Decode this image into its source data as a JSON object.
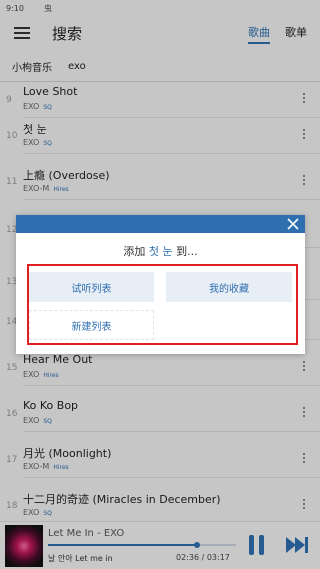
{
  "status": {
    "time": "9:10",
    "bug": "虫"
  },
  "app_bar": {
    "title": "搜索",
    "tab_songs": "歌曲",
    "tab_playlists": "歌单"
  },
  "search": {
    "source": "小枸音乐",
    "query": "exo"
  },
  "songs": [
    {
      "num": "9",
      "title": "Love Shot",
      "artist": "EXO",
      "badge": "SQ"
    },
    {
      "num": "10",
      "title": "첫 눈",
      "artist": "EXO",
      "badge": "SQ"
    },
    {
      "num": "11",
      "title": "上瘾 (Overdose)",
      "artist": "EXO-M",
      "badge": "Hires"
    },
    {
      "num": "12",
      "title": "",
      "artist": "",
      "badge": ""
    },
    {
      "num": "13",
      "title": "",
      "artist": "",
      "badge": ""
    },
    {
      "num": "14",
      "title": "",
      "artist": "",
      "badge": ""
    },
    {
      "num": "15",
      "title": "Hear Me Out",
      "artist": "EXO",
      "badge": "Hires"
    },
    {
      "num": "16",
      "title": "Ko Ko Bop",
      "artist": "EXO",
      "badge": "SQ"
    },
    {
      "num": "17",
      "title": "月光 (Moonlight)",
      "artist": "EXO-M",
      "badge": "Hires"
    },
    {
      "num": "18",
      "title": "十二月的奇迹 (Miracles in December)",
      "artist": "EXO",
      "badge": "SQ"
    }
  ],
  "dialog": {
    "prefix": "添加 ",
    "song": "첫 눈",
    "suffix": " 到...",
    "option_trial": "试听列表",
    "option_fav": "我的收藏",
    "option_new": "新建列表"
  },
  "player": {
    "title": "Let Me In - EXO",
    "subtitle": "날 안아 Let me in",
    "time": "02:36 / 03:17",
    "progress": 0.79
  },
  "colors": {
    "accent": "#2f6fb0",
    "highlight": "#e02020"
  }
}
